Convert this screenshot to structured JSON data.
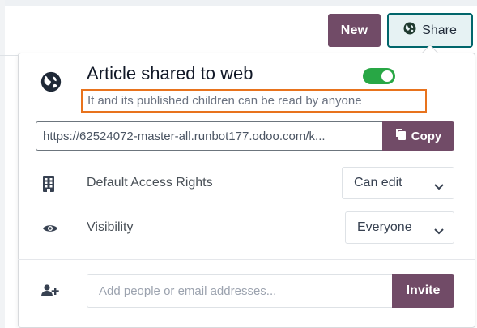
{
  "header": {
    "new_label": "New",
    "share_label": "Share"
  },
  "share_panel": {
    "title": "Article shared to web",
    "subtitle": "It and its published children can be read by anyone",
    "web_shared_enabled": true,
    "url_value": "https://62524072-master-all.runbot177.odoo.com/k...",
    "copy_label": "Copy",
    "default_access": {
      "label": "Default Access Rights",
      "value": "Can edit"
    },
    "visibility": {
      "label": "Visibility",
      "value": "Everyone"
    },
    "invite": {
      "placeholder": "Add people or email addresses...",
      "button_label": "Invite"
    }
  },
  "colors": {
    "primary": "#714B67",
    "share_border": "#01666b",
    "toggle_on": "#28a745",
    "highlight_box": "#e8731d"
  },
  "icons": {
    "share": "globe-icon",
    "title": "globe-icon",
    "copy": "copy-icon",
    "access": "building-icon",
    "visibility": "eye-icon",
    "invite": "user-plus-icon"
  }
}
